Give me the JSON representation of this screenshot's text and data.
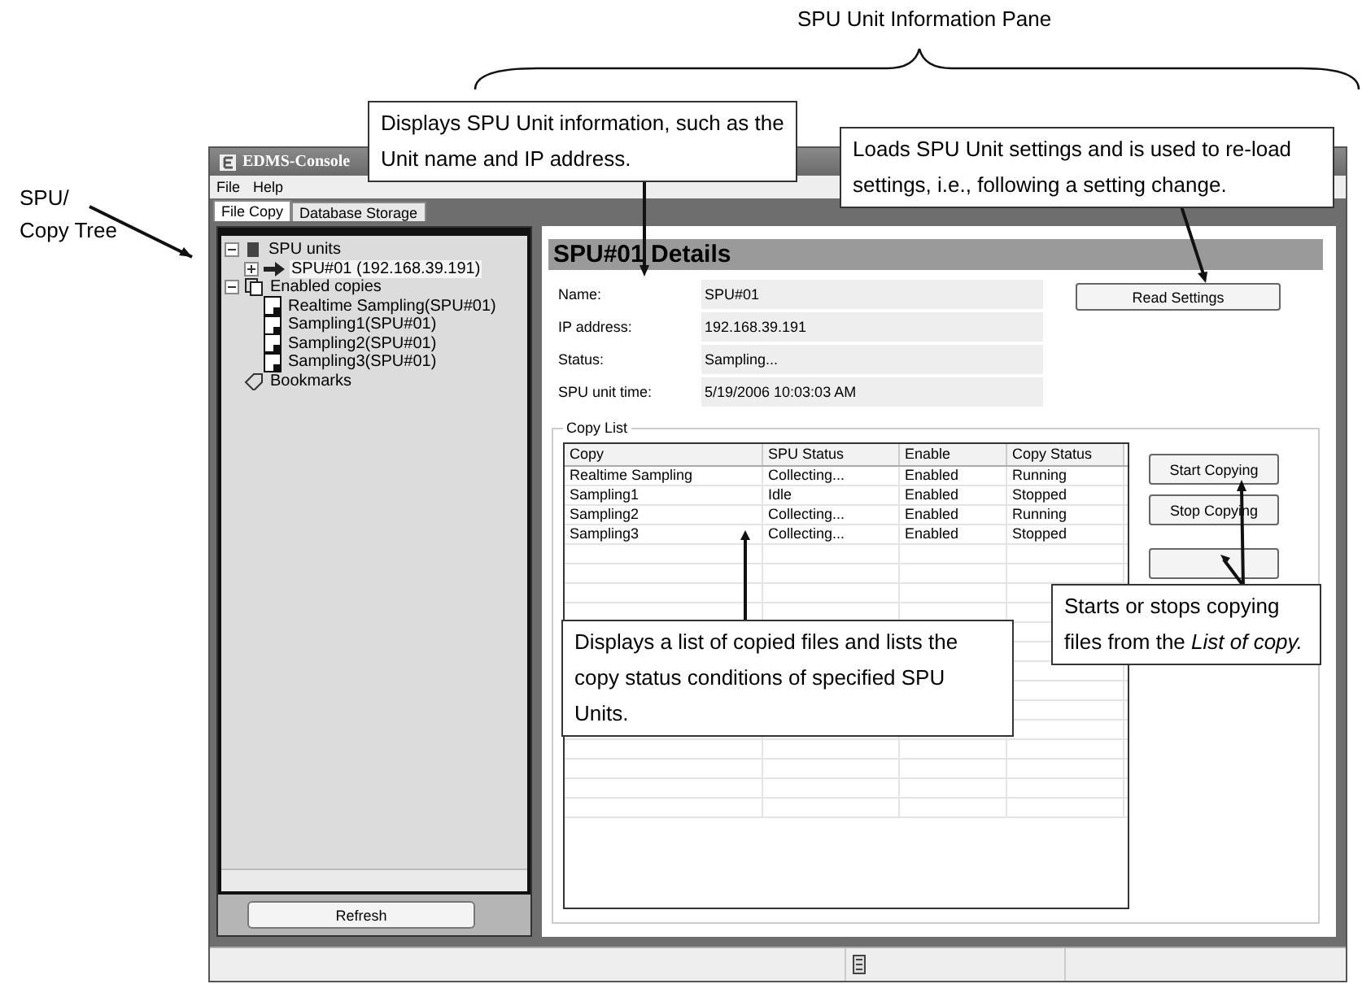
{
  "annotations": {
    "pane_label": "SPU Unit Information Pane",
    "tree_label": "SPU/ Copy Tree",
    "callouts": [
      {
        "text": "Displays SPU Unit information, such as the Unit name and IP address."
      },
      {
        "text": "Loads SPU Unit settings and is used to re-load settings, i.e., following a setting change."
      },
      {
        "text": "Displays a list of copied files and lists the copy status conditions of specified SPU Units."
      },
      {
        "text": "Starts or stops copying files from the *List of copy.*"
      }
    ]
  },
  "window": {
    "title": "EDMS-Console",
    "menu": [
      "File",
      "Help"
    ],
    "tabs": [
      {
        "label": "File Copy",
        "selected": true
      },
      {
        "label": "Database Storage",
        "selected": false
      }
    ],
    "tree": [
      {
        "label": "SPU units",
        "kind": "units",
        "expanded": true,
        "selected": false,
        "children": [
          {
            "label": "SPU#01 (192.168.39.191)",
            "kind": "unit",
            "expanded": false,
            "selected": true
          }
        ]
      },
      {
        "label": "Enabled copies",
        "kind": "copies",
        "expanded": true,
        "selected": false,
        "children": [
          {
            "label": "Realtime Sampling(SPU#01)",
            "kind": "file",
            "selected": false
          },
          {
            "label": "Sampling1(SPU#01)",
            "kind": "file",
            "selected": false
          },
          {
            "label": "Sampling2(SPU#01)",
            "kind": "file",
            "selected": false
          },
          {
            "label": "Sampling3(SPU#01)",
            "kind": "file",
            "selected": false
          }
        ]
      },
      {
        "label": "Bookmarks",
        "kind": "bookmarks",
        "selected": false
      }
    ],
    "refresh_button": "Refresh",
    "details": {
      "title": "SPU#01 Details",
      "fields": [
        {
          "label": "Name:",
          "value": "SPU#01"
        },
        {
          "label": "IP address:",
          "value": "192.168.39.191"
        },
        {
          "label": "Status:",
          "value": "Sampling..."
        },
        {
          "label": "SPU unit time:",
          "value": "5/19/2006 10:03:03 AM"
        }
      ],
      "read_button": "Read Settings"
    },
    "copy_list": {
      "title": "Copy List",
      "columns": [
        "Copy",
        "SPU Status",
        "Enable",
        "Copy Status"
      ],
      "rows": [
        [
          "Realtime Sampling",
          "Collecting...",
          "Enabled",
          "Running"
        ],
        [
          "Sampling1",
          "Idle",
          "Enabled",
          "Stopped"
        ],
        [
          "Sampling2",
          "Collecting...",
          "Enabled",
          "Running"
        ],
        [
          "Sampling3",
          "Collecting...",
          "Enabled",
          "Stopped"
        ]
      ],
      "buttons": [
        "Start Copying",
        "Stop Copying"
      ]
    }
  }
}
